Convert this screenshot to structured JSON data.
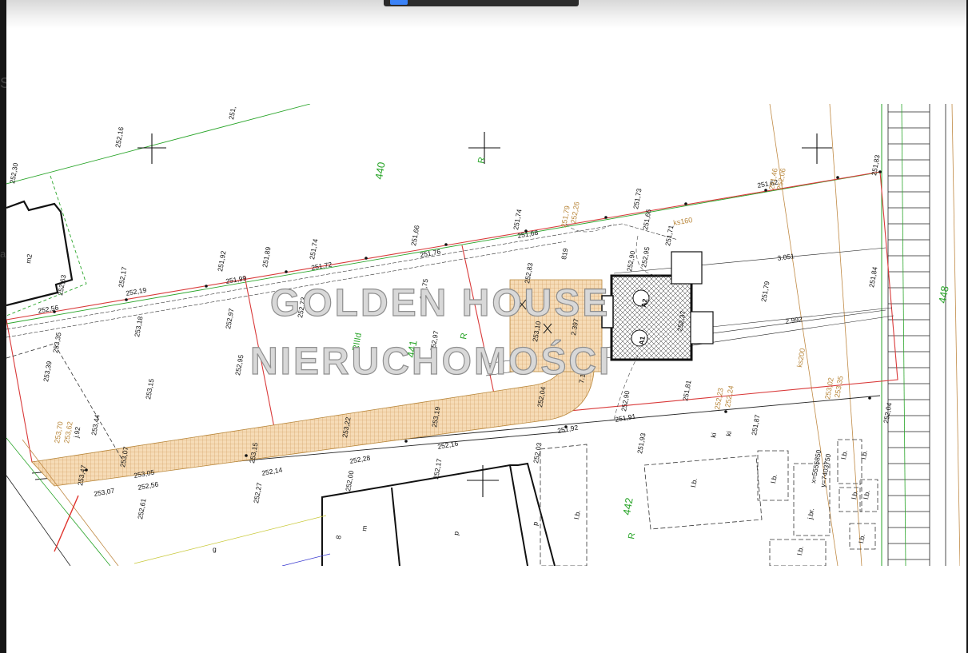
{
  "watermark": {
    "line1": "GOLDEN HOUSE",
    "line2": "NIERUCHOMOŚCI"
  },
  "edge": {
    "letter_top": "S",
    "letter_mid": "a"
  },
  "parcels": {
    "p440": "440",
    "p441": "441",
    "p442": "442",
    "p448": "448",
    "r1": "R",
    "r2": "R",
    "r3": "R",
    "rivd": "RIIId"
  },
  "buildings": {
    "a1": "A1",
    "a2": "A2",
    "m2": "m2",
    "l1": "l.b.",
    "l2": "l.b.",
    "l3": "l.b.",
    "l4": "l.b.",
    "l5": "l.b.",
    "l6": "l.b.",
    "l7": "l.b.",
    "l8": "l.b.",
    "l9": "l.b.",
    "jbr": "j.br.",
    "p1": "p",
    "p2": "p",
    "m": "m",
    "n8": "8",
    "g": "g"
  },
  "measures": {
    "ks160": "ks160",
    "ks200": "ks200",
    "d3051": "3.051",
    "d2992": "2.992",
    "d2397": "2.397",
    "d819": "819",
    "d719": "7.19",
    "x": "x=5555850",
    "y": "y=7403750",
    "ki1": "ki",
    "ki2": "ki",
    "j92": "j.92"
  },
  "elevations": {
    "e1": "252,30",
    "e2": "252,16",
    "e3": "251,",
    "e4": "252,63",
    "e5": "252,56",
    "e6": "253,35",
    "e7": "253,39",
    "e8": "252,17",
    "e9": "252,19",
    "e10": "253,18",
    "e11": "251,92",
    "e12": "251,99",
    "e13": "251,89",
    "e14": "252,97",
    "e15": "252,95",
    "e16": "251,74",
    "e17": "251,72",
    "e18": "252,73",
    "e19": "251,66",
    "e20": "251,76",
    "e21": "252,75",
    "e22": "252,97",
    "e23": "251,74",
    "e24": "251,68",
    "e25": "252,83",
    "e26": "253,10",
    "e27": "251,73",
    "e28": "251,66",
    "e29": "251,71",
    "e30": "252,90",
    "e31": "252,95",
    "e32": "251,62",
    "e33": "251,83",
    "e34": "251,79",
    "e35": "251,84",
    "e36": "253,15",
    "e37": "253,44",
    "e38": "253,47",
    "e39": "253,07",
    "e40": "253,05",
    "e41": "252,56",
    "e42": "253,07",
    "e43": "252,61",
    "e44": "252,27",
    "e45": "252,14",
    "e46": "252,28",
    "e47": "252,00",
    "e48": "252,17",
    "e49": "252,16",
    "e50": "252,03",
    "e51": "252,04",
    "e52": "251,92",
    "e53": "251,91",
    "e54": "251,93",
    "e55": "252,90",
    "e56": "251,81",
    "e57": "251,87",
    "e58": "252,04",
    "e59": "253,22",
    "e60": "253,19",
    "e61": "253,15",
    "e62": "252,37",
    "o1": "251,79",
    "o2": "252,26",
    "o3": "251,46",
    "o4": "252,06",
    "o5": "252,23",
    "o6": "252,24",
    "o7": "253,02",
    "o8": "253,35",
    "o9": "253,70",
    "o10": "253,62"
  },
  "colors": {
    "frame": "#161616",
    "boundary_red": "#d93a3a",
    "boundary_green": "#2aa52a",
    "utility_orange": "#c08a45",
    "hatch_fill": "#f4d7b0",
    "watermark": "#d8d8d8"
  },
  "icons": {
    "cross_marker": "survey-cross-icon",
    "hatch": "paving-hatch"
  }
}
